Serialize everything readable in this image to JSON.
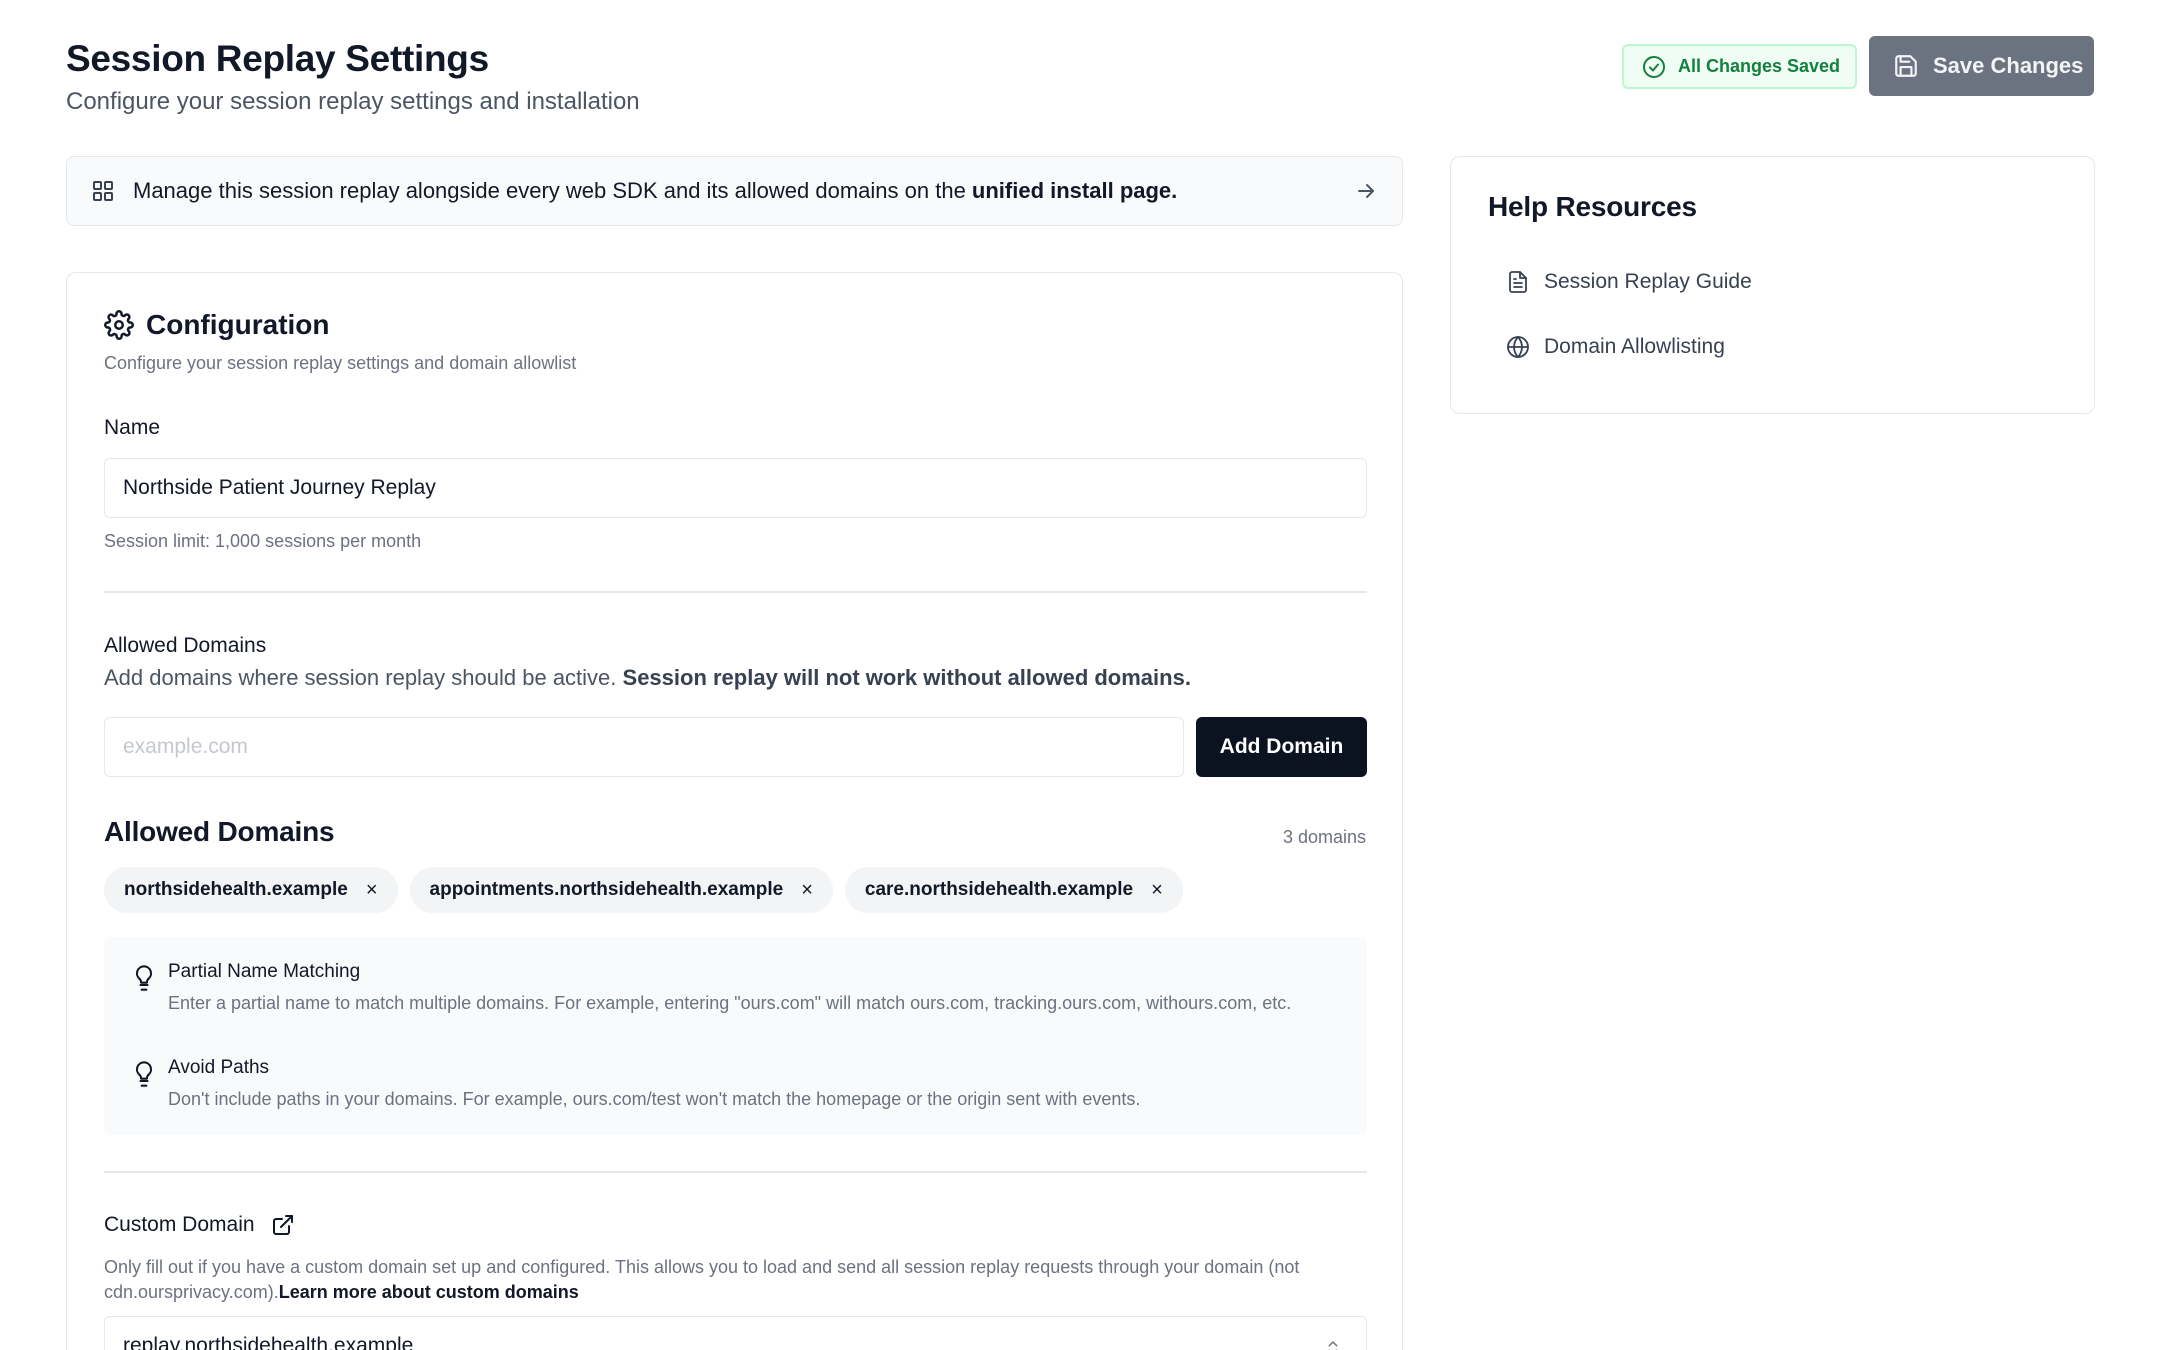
{
  "header": {
    "title": "Session Replay Settings",
    "subtitle": "Configure your session replay settings and installation",
    "saved_label": "All Changes Saved",
    "save_label": "Save Changes"
  },
  "banner": {
    "text_before": "Manage this session replay alongside every web SDK and its allowed domains on the ",
    "link": "unified install page."
  },
  "config": {
    "title": "Configuration",
    "subtitle": "Configure your session replay settings and domain allowlist",
    "name_label": "Name",
    "name_value": "Northside Patient Journey Replay",
    "session_limit": "Session limit: 1,000 sessions per month",
    "allowed_label": "Allowed Domains",
    "allowed_desc": "Add domains where session replay should be active. ",
    "allowed_warning": "Session replay will not work without allowed domains.",
    "domain_placeholder": "example.com",
    "add_label": "Add Domain",
    "list_title": "Allowed Domains",
    "list_count": "3 domains",
    "domains": [
      "northsidehealth.example",
      "appointments.northsidehealth.example",
      "care.northsidehealth.example"
    ],
    "remove_glyph": "×",
    "tips": [
      {
        "title": "Partial Name Matching",
        "body": "Enter a partial name to match multiple domains. For example, entering \"ours.com\" will match ours.com, tracking.ours.com, withours.com, etc."
      },
      {
        "title": "Avoid Paths",
        "body": "Don't include paths in your domains. For example, ours.com/test won't match the homepage or the origin sent with events."
      }
    ],
    "custom_label": "Custom Domain",
    "custom_desc": "Only fill out if you have a custom domain set up and configured. This allows you to load and send all session replay requests through your domain (not cdn.oursprivacy.com).",
    "custom_link": "Learn more about custom domains",
    "custom_value": "replay.northsidehealth.example"
  },
  "help": {
    "title": "Help Resources",
    "links": [
      {
        "label": "Session Replay Guide",
        "icon": "document-icon"
      },
      {
        "label": "Domain Allowlisting",
        "icon": "globe-icon"
      }
    ]
  },
  "colors": {
    "saved_green": "#15803d",
    "save_button_bg": "#6b7280",
    "add_button_bg": "#0b1320"
  }
}
